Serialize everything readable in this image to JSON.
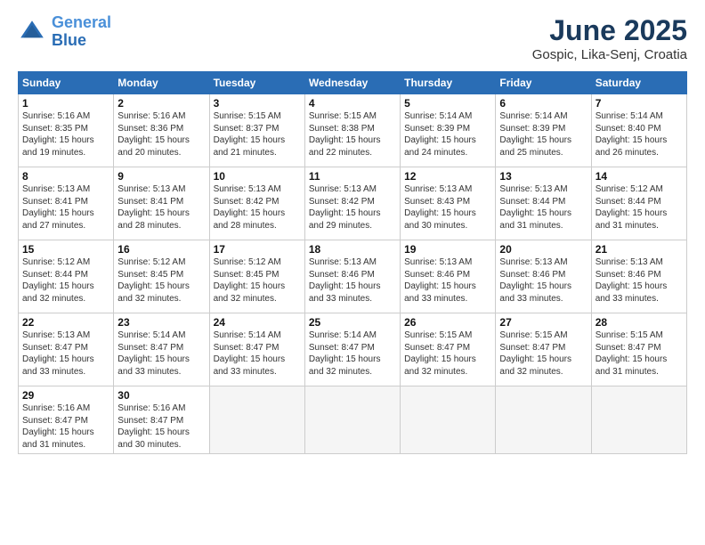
{
  "logo": {
    "line1": "General",
    "line2": "Blue"
  },
  "title": "June 2025",
  "subtitle": "Gospic, Lika-Senj, Croatia",
  "calendar": {
    "headers": [
      "Sunday",
      "Monday",
      "Tuesday",
      "Wednesday",
      "Thursday",
      "Friday",
      "Saturday"
    ],
    "weeks": [
      [
        {
          "day": "1",
          "info": "Sunrise: 5:16 AM\nSunset: 8:35 PM\nDaylight: 15 hours\nand 19 minutes."
        },
        {
          "day": "2",
          "info": "Sunrise: 5:16 AM\nSunset: 8:36 PM\nDaylight: 15 hours\nand 20 minutes."
        },
        {
          "day": "3",
          "info": "Sunrise: 5:15 AM\nSunset: 8:37 PM\nDaylight: 15 hours\nand 21 minutes."
        },
        {
          "day": "4",
          "info": "Sunrise: 5:15 AM\nSunset: 8:38 PM\nDaylight: 15 hours\nand 22 minutes."
        },
        {
          "day": "5",
          "info": "Sunrise: 5:14 AM\nSunset: 8:39 PM\nDaylight: 15 hours\nand 24 minutes."
        },
        {
          "day": "6",
          "info": "Sunrise: 5:14 AM\nSunset: 8:39 PM\nDaylight: 15 hours\nand 25 minutes."
        },
        {
          "day": "7",
          "info": "Sunrise: 5:14 AM\nSunset: 8:40 PM\nDaylight: 15 hours\nand 26 minutes."
        }
      ],
      [
        {
          "day": "8",
          "info": "Sunrise: 5:13 AM\nSunset: 8:41 PM\nDaylight: 15 hours\nand 27 minutes."
        },
        {
          "day": "9",
          "info": "Sunrise: 5:13 AM\nSunset: 8:41 PM\nDaylight: 15 hours\nand 28 minutes."
        },
        {
          "day": "10",
          "info": "Sunrise: 5:13 AM\nSunset: 8:42 PM\nDaylight: 15 hours\nand 28 minutes."
        },
        {
          "day": "11",
          "info": "Sunrise: 5:13 AM\nSunset: 8:42 PM\nDaylight: 15 hours\nand 29 minutes."
        },
        {
          "day": "12",
          "info": "Sunrise: 5:13 AM\nSunset: 8:43 PM\nDaylight: 15 hours\nand 30 minutes."
        },
        {
          "day": "13",
          "info": "Sunrise: 5:13 AM\nSunset: 8:44 PM\nDaylight: 15 hours\nand 31 minutes."
        },
        {
          "day": "14",
          "info": "Sunrise: 5:12 AM\nSunset: 8:44 PM\nDaylight: 15 hours\nand 31 minutes."
        }
      ],
      [
        {
          "day": "15",
          "info": "Sunrise: 5:12 AM\nSunset: 8:44 PM\nDaylight: 15 hours\nand 32 minutes."
        },
        {
          "day": "16",
          "info": "Sunrise: 5:12 AM\nSunset: 8:45 PM\nDaylight: 15 hours\nand 32 minutes."
        },
        {
          "day": "17",
          "info": "Sunrise: 5:12 AM\nSunset: 8:45 PM\nDaylight: 15 hours\nand 32 minutes."
        },
        {
          "day": "18",
          "info": "Sunrise: 5:13 AM\nSunset: 8:46 PM\nDaylight: 15 hours\nand 33 minutes."
        },
        {
          "day": "19",
          "info": "Sunrise: 5:13 AM\nSunset: 8:46 PM\nDaylight: 15 hours\nand 33 minutes."
        },
        {
          "day": "20",
          "info": "Sunrise: 5:13 AM\nSunset: 8:46 PM\nDaylight: 15 hours\nand 33 minutes."
        },
        {
          "day": "21",
          "info": "Sunrise: 5:13 AM\nSunset: 8:46 PM\nDaylight: 15 hours\nand 33 minutes."
        }
      ],
      [
        {
          "day": "22",
          "info": "Sunrise: 5:13 AM\nSunset: 8:47 PM\nDaylight: 15 hours\nand 33 minutes."
        },
        {
          "day": "23",
          "info": "Sunrise: 5:14 AM\nSunset: 8:47 PM\nDaylight: 15 hours\nand 33 minutes."
        },
        {
          "day": "24",
          "info": "Sunrise: 5:14 AM\nSunset: 8:47 PM\nDaylight: 15 hours\nand 33 minutes."
        },
        {
          "day": "25",
          "info": "Sunrise: 5:14 AM\nSunset: 8:47 PM\nDaylight: 15 hours\nand 32 minutes."
        },
        {
          "day": "26",
          "info": "Sunrise: 5:15 AM\nSunset: 8:47 PM\nDaylight: 15 hours\nand 32 minutes."
        },
        {
          "day": "27",
          "info": "Sunrise: 5:15 AM\nSunset: 8:47 PM\nDaylight: 15 hours\nand 32 minutes."
        },
        {
          "day": "28",
          "info": "Sunrise: 5:15 AM\nSunset: 8:47 PM\nDaylight: 15 hours\nand 31 minutes."
        }
      ],
      [
        {
          "day": "29",
          "info": "Sunrise: 5:16 AM\nSunset: 8:47 PM\nDaylight: 15 hours\nand 31 minutes."
        },
        {
          "day": "30",
          "info": "Sunrise: 5:16 AM\nSunset: 8:47 PM\nDaylight: 15 hours\nand 30 minutes."
        },
        {
          "day": "",
          "info": ""
        },
        {
          "day": "",
          "info": ""
        },
        {
          "day": "",
          "info": ""
        },
        {
          "day": "",
          "info": ""
        },
        {
          "day": "",
          "info": ""
        }
      ]
    ]
  }
}
